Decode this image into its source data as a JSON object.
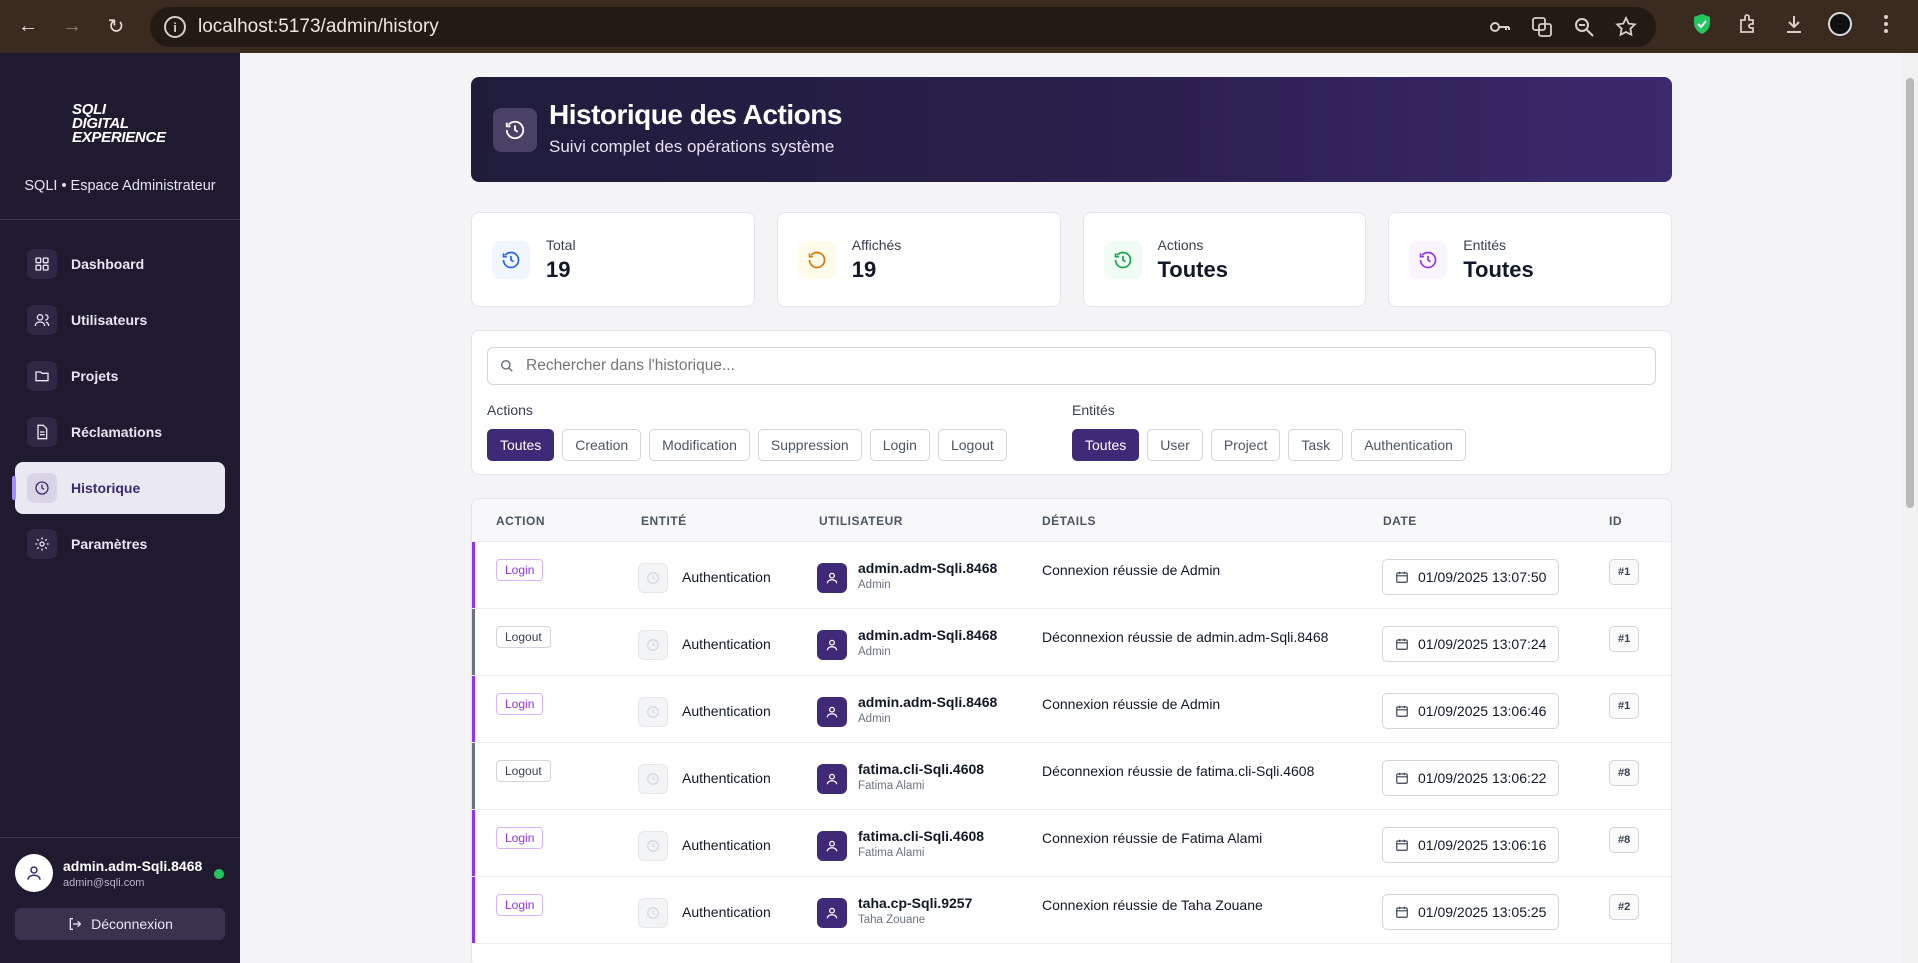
{
  "browser": {
    "url": "localhost:5173/admin/history"
  },
  "sidebar": {
    "logo_lines": [
      "SQLI",
      "DIGITAL",
      "EXPERIENCE"
    ],
    "brand": "SQLI • Espace Administrateur",
    "items": [
      {
        "label": "Dashboard",
        "icon": "grid-icon"
      },
      {
        "label": "Utilisateurs",
        "icon": "users-icon"
      },
      {
        "label": "Projets",
        "icon": "folder-icon"
      },
      {
        "label": "Réclamations",
        "icon": "document-icon"
      },
      {
        "label": "Historique",
        "icon": "clock-icon",
        "active": true
      },
      {
        "label": "Paramètres",
        "icon": "gear-icon"
      }
    ],
    "user": {
      "username": "admin.adm-Sqli.8468",
      "email": "admin@sqli.com",
      "logout_label": "Déconnexion"
    }
  },
  "header": {
    "title": "Historique des Actions",
    "subtitle": "Suivi complet des opérations système"
  },
  "stats": [
    {
      "label": "Total",
      "value": "19",
      "color": "#2563eb"
    },
    {
      "label": "Affichés",
      "value": "19",
      "color": "#d97706"
    },
    {
      "label": "Actions",
      "value": "Toutes",
      "color": "#16a34a"
    },
    {
      "label": "Entités",
      "value": "Toutes",
      "color": "#9333ea"
    }
  ],
  "filters": {
    "search_placeholder": "Rechercher dans l'historique...",
    "actions_title": "Actions",
    "actions": [
      "Toutes",
      "Creation",
      "Modification",
      "Suppression",
      "Login",
      "Logout"
    ],
    "entities_title": "Entités",
    "entities": [
      "Toutes",
      "User",
      "Project",
      "Task",
      "Authentication"
    ]
  },
  "table": {
    "headers": [
      "ACTION",
      "ENTITÉ",
      "UTILISATEUR",
      "DÉTAILS",
      "DATE",
      "ID"
    ],
    "rows": [
      {
        "action": "Login",
        "entity": "Authentication",
        "user": "admin.adm-Sqli.8468",
        "user_name": "Admin",
        "details": "Connexion réussie de Admin",
        "date": "01/09/2025 13:07:50",
        "id": "#1"
      },
      {
        "action": "Logout",
        "entity": "Authentication",
        "user": "admin.adm-Sqli.8468",
        "user_name": "Admin",
        "details": "Déconnexion réussie de admin.adm-Sqli.8468",
        "date": "01/09/2025 13:07:24",
        "id": "#1"
      },
      {
        "action": "Login",
        "entity": "Authentication",
        "user": "admin.adm-Sqli.8468",
        "user_name": "Admin",
        "details": "Connexion réussie de Admin",
        "date": "01/09/2025 13:06:46",
        "id": "#1"
      },
      {
        "action": "Logout",
        "entity": "Authentication",
        "user": "fatima.cli-Sqli.4608",
        "user_name": "Fatima Alami",
        "details": "Déconnexion réussie de fatima.cli-Sqli.4608",
        "date": "01/09/2025 13:06:22",
        "id": "#8"
      },
      {
        "action": "Login",
        "entity": "Authentication",
        "user": "fatima.cli-Sqli.4608",
        "user_name": "Fatima Alami",
        "details": "Connexion réussie de Fatima Alami",
        "date": "01/09/2025 13:06:16",
        "id": "#8"
      },
      {
        "action": "Login",
        "entity": "Authentication",
        "user": "taha.cp-Sqli.9257",
        "user_name": "Taha Zouane",
        "details": "Connexion réussie de Taha Zouane",
        "date": "01/09/2025 13:05:25",
        "id": "#2"
      }
    ]
  },
  "colors": {
    "accent": "#3f2a78",
    "sidebar_bg": "#1f1a30",
    "login": "#9333ea",
    "logout": "#6b7280"
  }
}
